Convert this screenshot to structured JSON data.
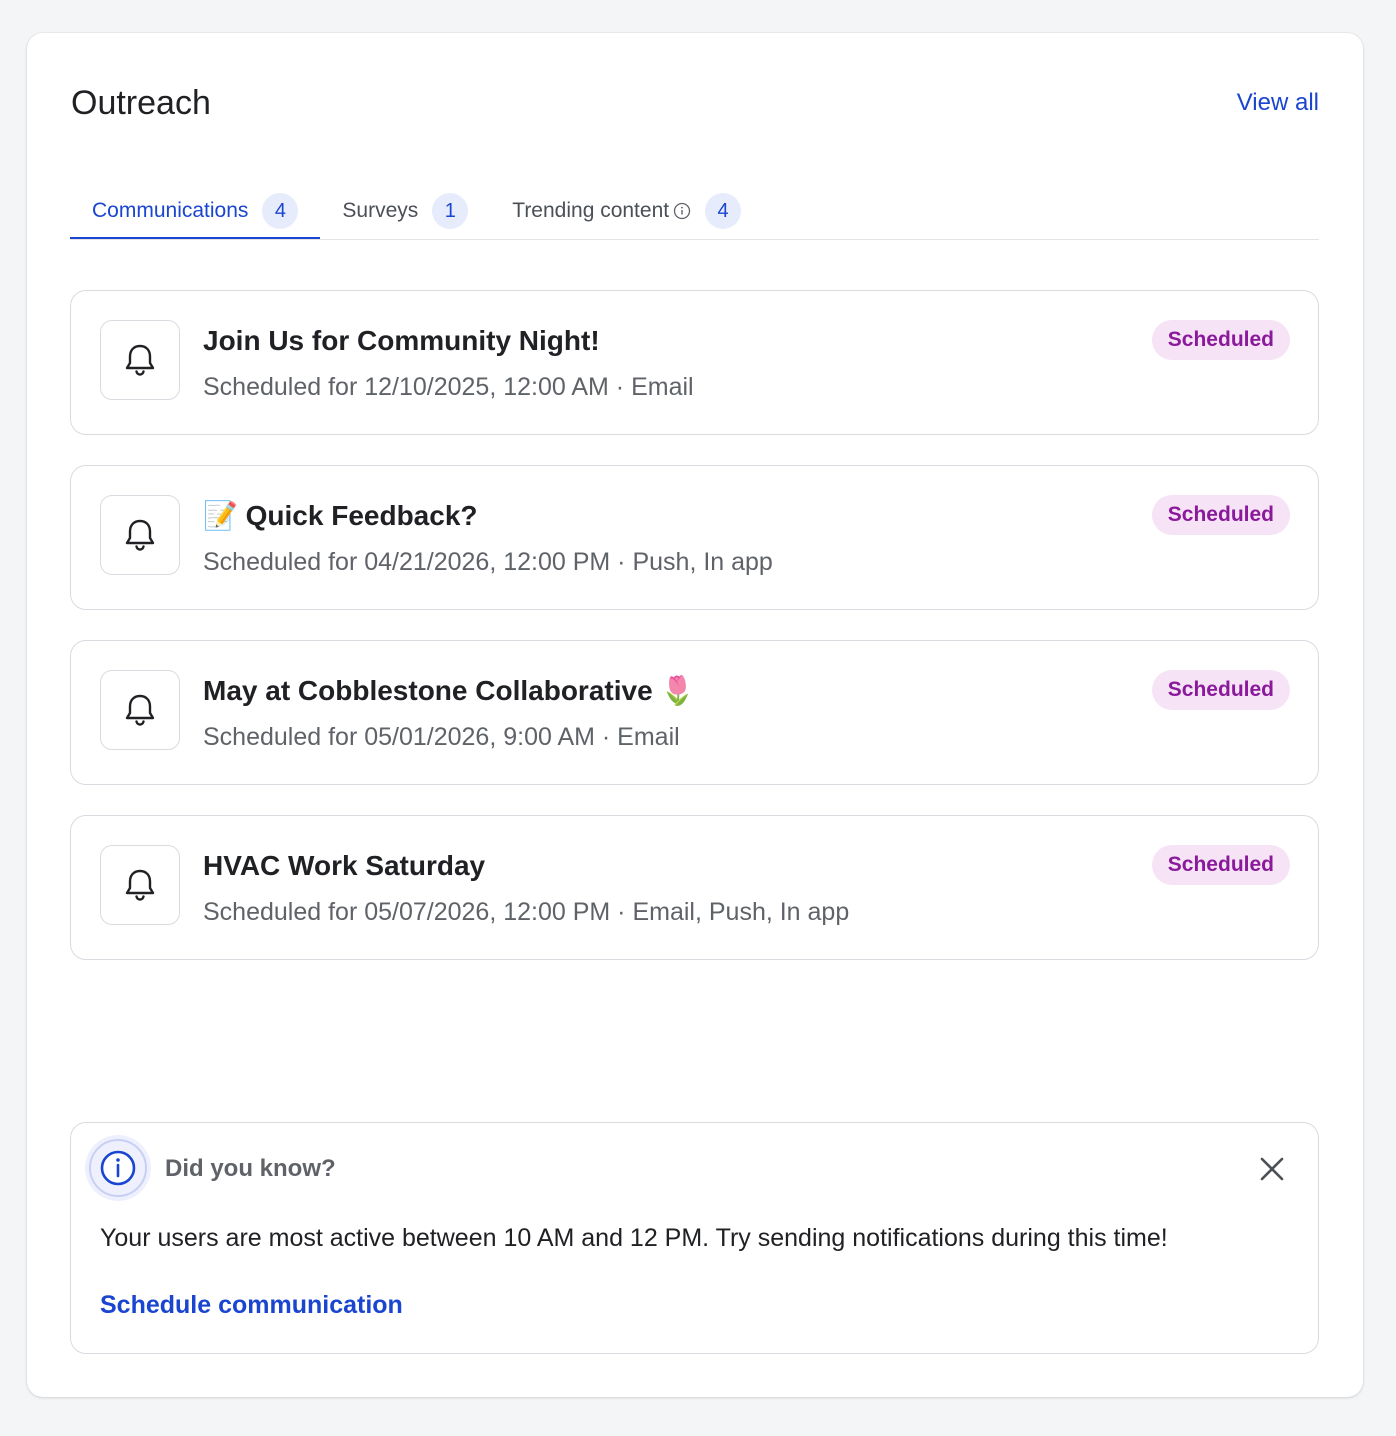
{
  "header": {
    "title": "Outreach",
    "view_all": "View all"
  },
  "tabs": [
    {
      "label": "Communications",
      "count": "4",
      "active": true
    },
    {
      "label": "Surveys",
      "count": "1",
      "active": false
    },
    {
      "label": "Trending content",
      "count": "4",
      "active": false,
      "icon": "info-icon"
    }
  ],
  "communications": [
    {
      "title": "Join Us for Community Night!",
      "subtitle": "Scheduled for 12/10/2025, 12:00 AM · Email",
      "status": "Scheduled",
      "icon": "bell-icon"
    },
    {
      "title": "📝 Quick Feedback?",
      "subtitle": "Scheduled for 04/21/2026, 12:00 PM · Push, In app",
      "status": "Scheduled",
      "icon": "bell-icon"
    },
    {
      "title": "May at Cobblestone Collaborative 🌷",
      "subtitle": "Scheduled for 05/01/2026, 9:00 AM · Email",
      "status": "Scheduled",
      "icon": "bell-icon"
    },
    {
      "title": "HVAC Work Saturday",
      "subtitle": "Scheduled for 05/07/2026, 12:00 PM · Email, Push, In app",
      "status": "Scheduled",
      "icon": "bell-icon"
    }
  ],
  "tip": {
    "title": "Did you know?",
    "body": "Your users are most active between 10 AM and 12 PM. Try sending notifications during this time!",
    "link": "Schedule communication",
    "icon": "info-icon"
  },
  "colors": {
    "accent": "#1a45d0",
    "badge_bg": "#f6e3f6",
    "badge_text": "#8a1a9b",
    "count_bg": "#e6ecfb"
  }
}
